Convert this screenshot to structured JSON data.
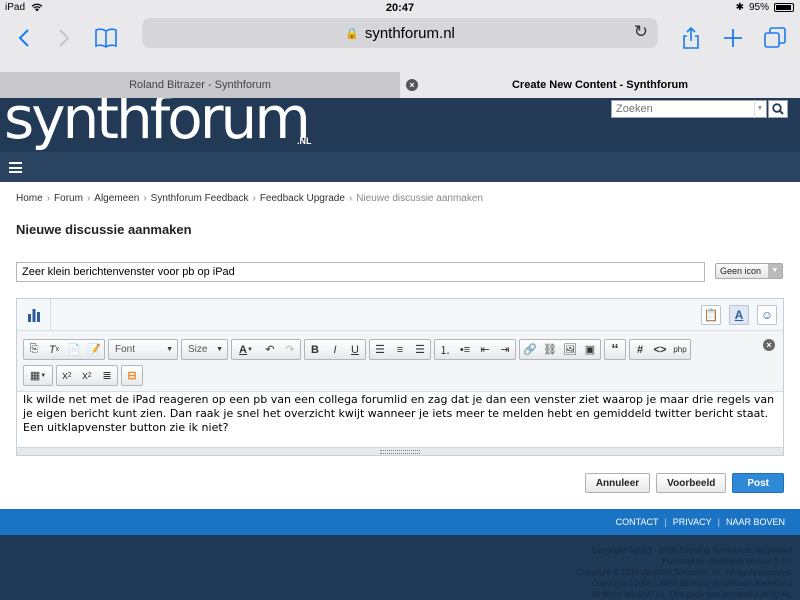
{
  "status_bar": {
    "device": "iPad",
    "time": "20:47",
    "battery": "95%",
    "battery_level": 0.95
  },
  "browser": {
    "url": "synthforum.nl",
    "tabs": [
      {
        "title": "Roland Bitrazer - Synthforum"
      },
      {
        "title": "Create New Content - Synthforum"
      }
    ]
  },
  "site": {
    "logo": "synthforum",
    "logo_suffix": ".NL",
    "search_placeholder": "Zoeken"
  },
  "breadcrumb": [
    "Home",
    "Forum",
    "Algemeen",
    "Synthforum Feedback",
    "Feedback Upgrade",
    "Nieuwe discussie aanmaken"
  ],
  "page_title": "Nieuwe discussie aanmaken",
  "form": {
    "subject": "Zeer klein berichtenvenster voor pb op iPad",
    "icon_select": "Geen icon",
    "font_dropdown": "Font",
    "size_dropdown": "Size",
    "body": "Ik wilde net met de iPad reageren op een pb van een collega forumlid en zag dat je dan een venster ziet waarop je maar drie regels van je eigen bericht kunt zien. Dan raak je snel het overzicht kwijt wanneer je iets meer te melden hebt en gemiddeld twitter bericht staat. Een uitklapvenster button zie ik niet?"
  },
  "buttons": {
    "cancel": "Annuleer",
    "preview": "Voorbeeld",
    "post": "Post"
  },
  "footer": {
    "links": [
      "CONTACT",
      "PRIVACY",
      "NAAR BOVEN"
    ],
    "copyright": [
      "Copyright ©2001 - 2018 Stichting Synthforum Nederland",
      "Powered by vBulletin® Version 5.4.3",
      "Copyright © 2018 vBulletin Solutions, Inc. All rights reserved.",
      "Copyright ©2001 - 2018 Stichting Synthforum Nederland",
      "All times are GMT+1. This page was generated at 20:44."
    ]
  },
  "colors": {
    "accent": "#1a7bf2",
    "header": "#223a56",
    "footer": "#1b73c3",
    "post_button": "#2f89d7"
  }
}
